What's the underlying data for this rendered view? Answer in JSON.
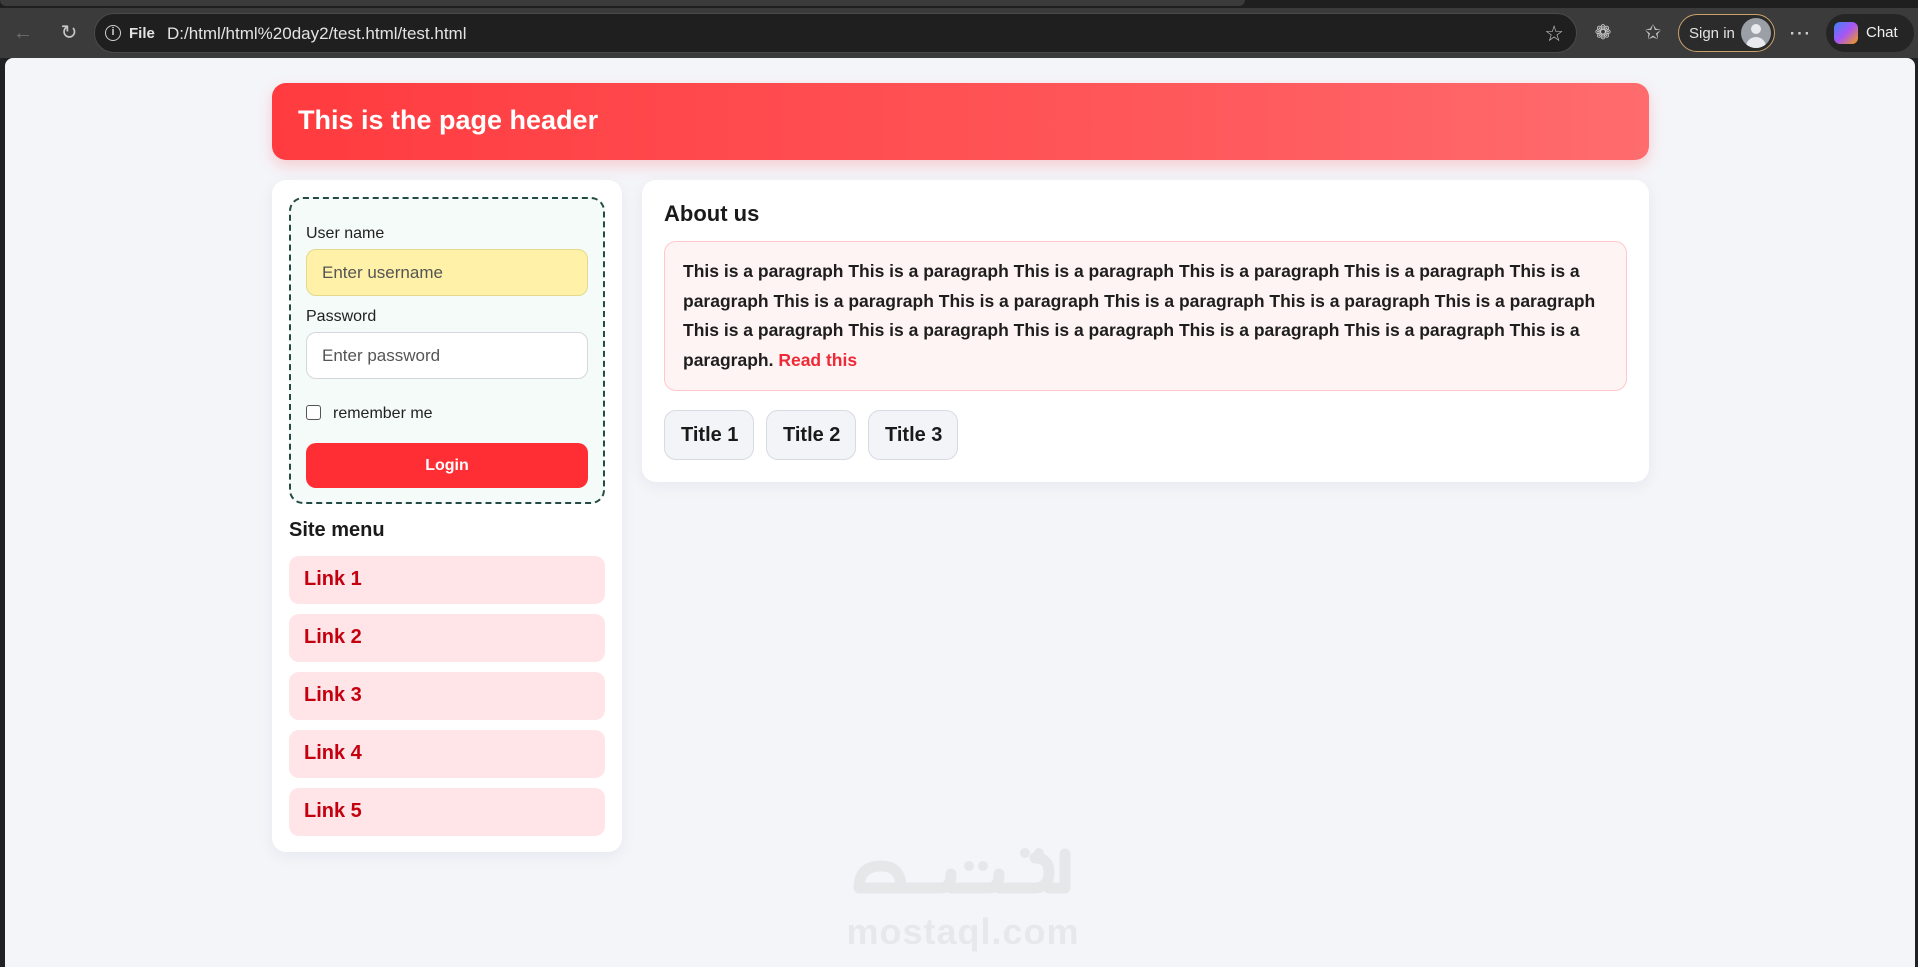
{
  "browser": {
    "address_prefix": "File",
    "url": "D:/html/html%20day2/test.html/test.html",
    "sign_in_label": "Sign in",
    "chat_label": "Chat",
    "icons": [
      "back-arrow-icon",
      "reload-icon",
      "info-icon",
      "star-icon",
      "extensions-icon",
      "favorites-icon",
      "more-icon",
      "copilot-icon"
    ]
  },
  "page": {
    "header_title": "This is the page header",
    "login": {
      "username_label": "User name",
      "username_placeholder": "Enter username",
      "password_label": "Password",
      "password_placeholder": "Enter password",
      "remember_label": "remember me",
      "login_button": "Login"
    },
    "site_menu": {
      "title": "Site menu",
      "links": [
        "Link 1",
        "Link 2",
        "Link 3",
        "Link 4",
        "Link 5"
      ]
    },
    "about": {
      "title": "About us",
      "paragraph": "This is a paragraph This is a paragraph This is a paragraph This is a paragraph This is a paragraph This is a paragraph This is a paragraph This is a paragraph This is a paragraph This is a paragraph This is a paragraph This is a paragraph This is a paragraph This is a paragraph This is a paragraph This is a paragraph This is a paragraph.",
      "read_more": "Read this",
      "tabs": [
        "Title 1",
        "Title 2",
        "Title 3"
      ]
    },
    "watermark": {
      "arabic_logo_text": "مستقل",
      "latin": "mostaql.com"
    },
    "colors": {
      "header": "#ff3b3f",
      "accent": "#ff2e35",
      "link": "#c4000f",
      "link_bg": "#ffe4e8",
      "username_field_bg": "#fff1a8",
      "page_bg": "#f4f5f9"
    }
  }
}
